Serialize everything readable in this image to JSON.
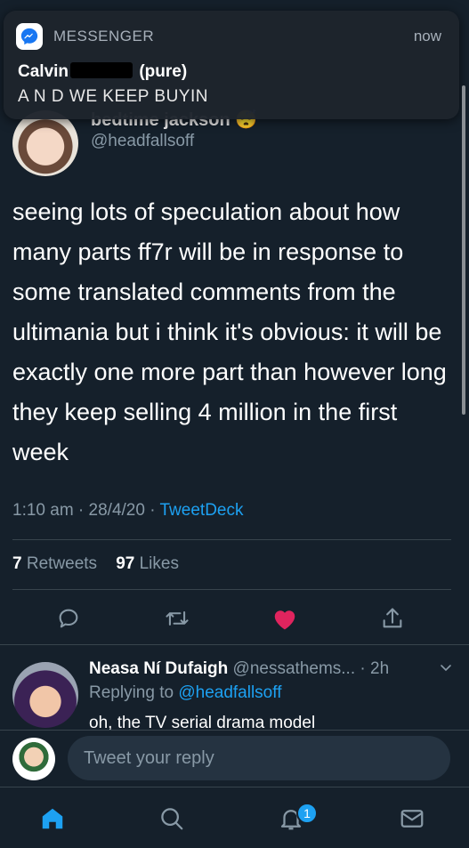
{
  "notification": {
    "app_name": "MESSENGER",
    "time": "now",
    "sender_first": "Calvin",
    "sender_suffix": "(pure)",
    "message": "A N D WE KEEP BUYIN",
    "icon": "messenger-icon"
  },
  "tweet": {
    "author_name": "bedtime jackson 😴",
    "author_handle": "@headfallsoff",
    "text": "seeing lots of speculation about how many parts ff7r will be in response to some translated comments from the ultimania but i think it's obvious: it will be exactly one more part than however long they keep selling 4 million in the first week",
    "time": "1:10 am",
    "date": "28/4/20",
    "source": "TweetDeck",
    "retweets_count": "7",
    "retweets_label": "Retweets",
    "likes_count": "97",
    "likes_label": "Likes"
  },
  "actions": {
    "reply_icon": "reply-icon",
    "retweet_icon": "retweet-icon",
    "like_icon": "heart-icon",
    "share_icon": "share-icon",
    "like_color": "#e0245e"
  },
  "reply": {
    "name": "Neasa Ní Dufaigh",
    "handle": "@nessathems...",
    "age": "· 2h",
    "replying_prefix": "Replying to",
    "replying_to": "@headfallsoff",
    "text": "oh, the TV serial drama model"
  },
  "compose": {
    "placeholder": "Tweet your reply"
  },
  "nav": {
    "items": [
      "home-icon",
      "search-icon",
      "notifications-icon",
      "messages-icon"
    ],
    "notifications_badge": "1"
  },
  "colors": {
    "background": "#15202b",
    "accent": "#1da1f2",
    "muted": "#8899a6",
    "divider": "#38444d"
  }
}
